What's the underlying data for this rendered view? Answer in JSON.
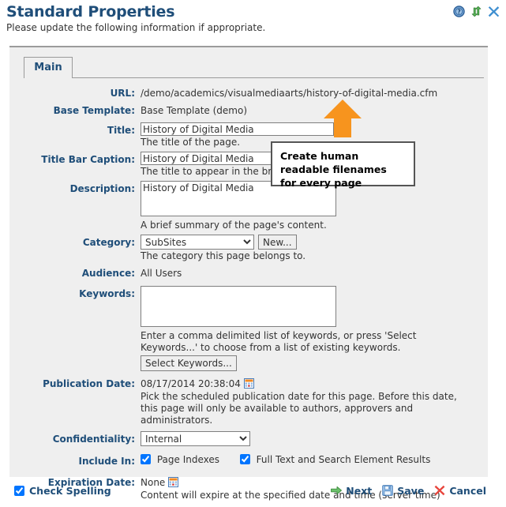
{
  "header": {
    "title": "Standard Properties",
    "subtitle": "Please update the following information if appropriate.",
    "icons": [
      {
        "name": "help-icon",
        "label": "Help"
      },
      {
        "name": "refresh-icon",
        "label": "Refresh"
      },
      {
        "name": "close-icon",
        "label": "Close"
      }
    ]
  },
  "tabs": [
    {
      "label": "Main",
      "selected": true
    }
  ],
  "form": {
    "url": {
      "label": "URL:",
      "value": "/demo/academics/visualmediaarts/history-of-digital-media.cfm"
    },
    "base_template": {
      "label": "Base Template:",
      "value": "Base Template (demo)"
    },
    "title": {
      "label": "Title:",
      "value": "History of Digital Media",
      "hint": "The title of the page."
    },
    "title_bar_caption": {
      "label": "Title Bar Caption:",
      "value": "History of Digital Media",
      "hint": "The title to appear in the browser title bar."
    },
    "description": {
      "label": "Description:",
      "value": "History of Digital Media",
      "hint": "A brief summary of the page's content."
    },
    "category": {
      "label": "Category:",
      "value": "SubSites",
      "options": [
        "SubSites"
      ],
      "new_button": "New...",
      "hint": "The category this page belongs to."
    },
    "audience": {
      "label": "Audience:",
      "value": "All Users"
    },
    "keywords": {
      "label": "Keywords:",
      "value": "",
      "hint": "Enter a comma delimited list of keywords, or press 'Select Keywords...' to choose from a list of existing keywords.",
      "select_button": "Select Keywords..."
    },
    "publication_date": {
      "label": "Publication Date:",
      "value": "08/17/2014 20:38:04",
      "hint": "Pick the scheduled publication date for this page. Before this date, this page will only be available to authors, approvers and administrators.",
      "calendar_icon": "calendar-icon"
    },
    "confidentiality": {
      "label": "Confidentiality:",
      "value": "Internal",
      "options": [
        "Internal"
      ]
    },
    "include_in": {
      "label": "Include In:",
      "checkboxes": [
        {
          "label": "Page Indexes",
          "checked": true
        },
        {
          "label": "Full Text and Search Element Results",
          "checked": true
        }
      ]
    },
    "expiration_date": {
      "label": "Expiration Date:",
      "value": "None",
      "hint": "Content will expire at the specified date and time (server time)",
      "calendar_icon": "calendar-icon"
    }
  },
  "annotation": {
    "callout_text": "Create human readable filenames for every page",
    "arrow_color": "#F7941E",
    "arrow_direction": "up"
  },
  "footer": {
    "check_spelling": {
      "label": "Check Spelling",
      "checked": true
    },
    "actions": [
      {
        "name": "next",
        "label": "Next",
        "icon": "arrow-right-icon",
        "color": "#4CA64C"
      },
      {
        "name": "save",
        "label": "Save",
        "icon": "floppy-disk-icon",
        "color": "#3C7CBF"
      },
      {
        "name": "cancel",
        "label": "Cancel",
        "icon": "red-x-icon",
        "color": "#E03030"
      }
    ]
  },
  "colors": {
    "label_blue": "#1F4E79",
    "panel_bg": "#efefef",
    "border_gray": "#9b9b9b"
  }
}
